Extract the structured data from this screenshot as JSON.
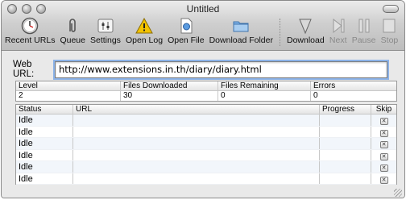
{
  "window": {
    "title": "Untitled"
  },
  "toolbar": {
    "items": [
      {
        "label": "Recent URLs",
        "icon": "clock-icon",
        "enabled": true
      },
      {
        "label": "Queue",
        "icon": "paperclip-icon",
        "enabled": true
      },
      {
        "label": "Settings",
        "icon": "sliders-icon",
        "enabled": true
      },
      {
        "label": "Open Log",
        "icon": "warning-icon",
        "enabled": true
      },
      {
        "label": "Open File",
        "icon": "file-icon",
        "enabled": true
      },
      {
        "label": "Download Folder",
        "icon": "folder-icon",
        "enabled": true
      },
      {
        "label": "Download",
        "icon": "download-arrow-icon",
        "enabled": true
      },
      {
        "label": "Next",
        "icon": "next-icon",
        "enabled": false
      },
      {
        "label": "Pause",
        "icon": "pause-icon",
        "enabled": false
      },
      {
        "label": "Stop",
        "icon": "stop-icon",
        "enabled": false
      }
    ]
  },
  "url": {
    "label": "Web URL:",
    "value": "http://www.extensions.in.th/diary/diary.html"
  },
  "stats": {
    "headers": [
      "Level",
      "Files Downloaded",
      "Files Remaining",
      "Errors"
    ],
    "values": [
      "2",
      "30",
      "0",
      "0"
    ]
  },
  "downloads": {
    "headers": [
      "Status",
      "URL",
      "Progress",
      "Skip"
    ],
    "rows": [
      {
        "status": "Idle",
        "url": "",
        "progress": ""
      },
      {
        "status": "Idle",
        "url": "",
        "progress": ""
      },
      {
        "status": "Idle",
        "url": "",
        "progress": ""
      },
      {
        "status": "Idle",
        "url": "",
        "progress": ""
      },
      {
        "status": "Idle",
        "url": "",
        "progress": ""
      },
      {
        "status": "Idle",
        "url": "",
        "progress": ""
      }
    ]
  },
  "colors": {
    "focus_ring": "#8cb3e8",
    "warning": "#f2c200",
    "folder": "#7fb2e6"
  }
}
